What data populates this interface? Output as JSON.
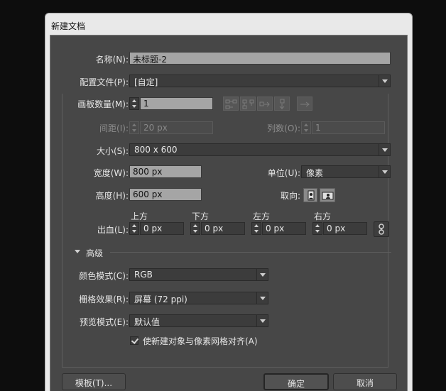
{
  "window": {
    "title": "新建文档"
  },
  "name": {
    "label": "名称(N):",
    "value": "未标题-2"
  },
  "profile": {
    "label": "配置文件(P):",
    "value": "[自定]"
  },
  "artboards": {
    "label": "画板数量(M):",
    "value": "1"
  },
  "spacing": {
    "label": "间距(I):",
    "value": "20 px"
  },
  "columns": {
    "label": "列数(O):",
    "value": "1"
  },
  "size": {
    "label": "大小(S):",
    "value": "800 x 600"
  },
  "width": {
    "label": "宽度(W):",
    "value": "800 px"
  },
  "units": {
    "label": "单位(U):",
    "value": "像素"
  },
  "height": {
    "label": "高度(H):",
    "value": "600 px"
  },
  "orientation": {
    "label": "取向:"
  },
  "bleed": {
    "label": "出血(L):",
    "top_label": "上方",
    "top": "0 px",
    "bottom_label": "下方",
    "bottom": "0 px",
    "left_label": "左方",
    "left": "0 px",
    "right_label": "右方",
    "right": "0 px"
  },
  "advanced": {
    "label": "高级",
    "color_mode": {
      "label": "颜色模式(C):",
      "value": "RGB"
    },
    "raster": {
      "label": "栅格效果(R):",
      "value": "屏幕 (72 ppi)"
    },
    "preview": {
      "label": "预览模式(E):",
      "value": "默认值"
    },
    "align_pixel": {
      "label": "使新建对象与像素网格对齐(A)",
      "checked": true
    }
  },
  "buttons": {
    "templates": "模板(T)...",
    "ok": "确定",
    "cancel": "取消"
  }
}
